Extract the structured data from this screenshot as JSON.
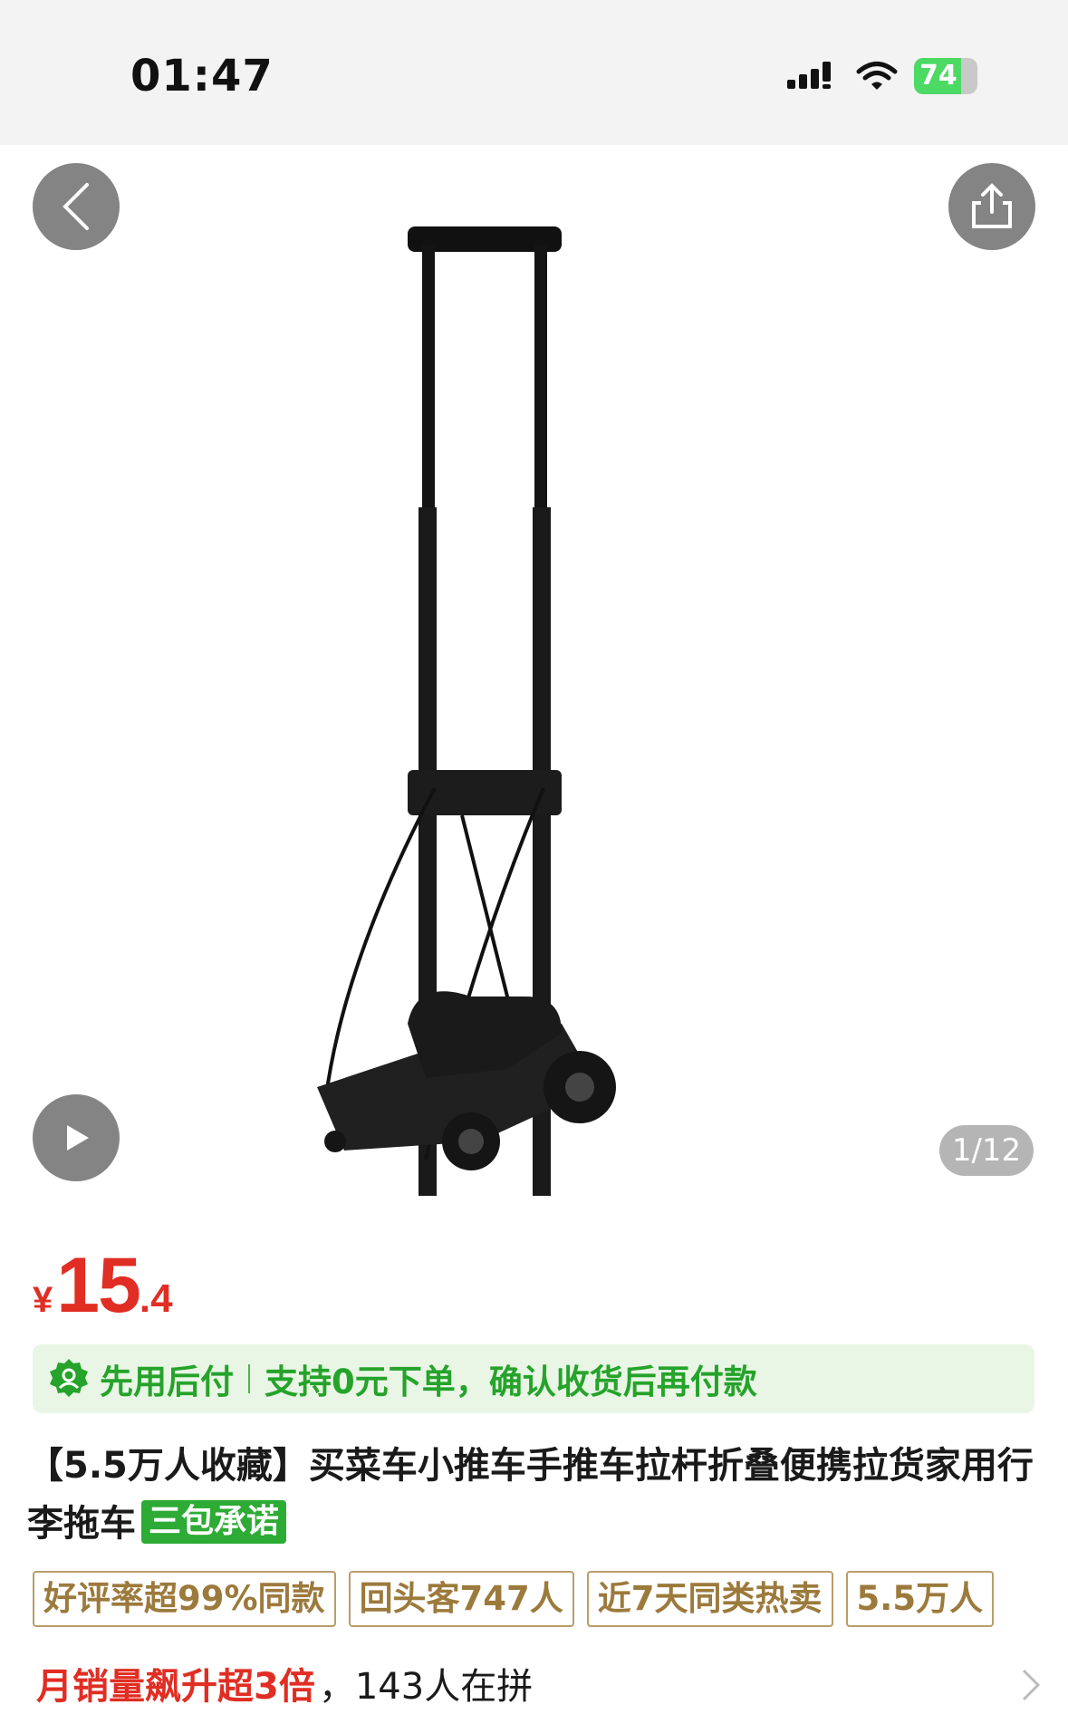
{
  "status_bar": {
    "time": "01:47",
    "battery": "74",
    "battery_level": 0.74,
    "icons": [
      "signal-icon",
      "wifi-icon",
      "battery-icon"
    ]
  },
  "gallery": {
    "counter": "1/12",
    "icons": [
      "back-arrow-icon",
      "share-icon",
      "play-icon"
    ]
  },
  "price": {
    "symbol": "¥",
    "integer": "15",
    "decimal": ".4",
    "color": "#e02e24"
  },
  "pay_later": {
    "title": "先用后付",
    "description": "支持0元下单，确认收货后再付款",
    "color": "#25a32a"
  },
  "product": {
    "title": "【5.5万人收藏】买菜车小推车手推车拉杆折叠便携拉货家用行李拖车",
    "badge": "三包承诺"
  },
  "tags": [
    "好评率超99%同款",
    "回头客747人",
    "近7天同类热卖",
    "5.5万人"
  ],
  "sales": {
    "highlight": "月销量飙升超3倍",
    "rest": "，143人在拼"
  }
}
